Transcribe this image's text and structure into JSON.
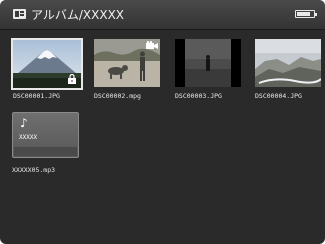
{
  "header": {
    "title": "アルバム/XXXXX",
    "battery_level_pct": 85
  },
  "items": [
    {
      "name": "DSC00001.JPG",
      "type": "photo",
      "locked": true,
      "selected": true
    },
    {
      "name": "DSC00002.mpg",
      "type": "video"
    },
    {
      "name": "DSC00003.JPG",
      "type": "photo"
    },
    {
      "name": "DSC00004.JPG",
      "type": "photo"
    },
    {
      "name": "XXXXX05.mp3",
      "type": "music",
      "title": "XXXXX"
    }
  ],
  "icons": {
    "header": "folder-icon",
    "lock": "lock-icon",
    "video": "video-camera-icon",
    "music": "music-note-icon",
    "battery": "battery-icon"
  },
  "colors": {
    "background": "#2a2a2a",
    "header": "#3d3d3d",
    "text": "#e8e8e8",
    "selection": "#e8e8e8"
  }
}
